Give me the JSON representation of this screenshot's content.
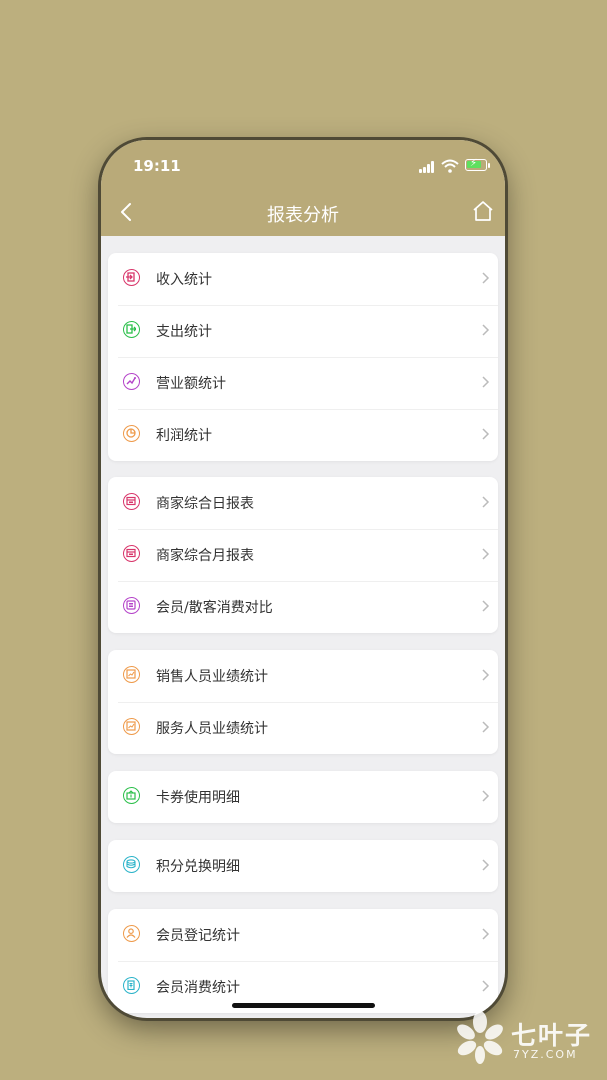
{
  "status_bar": {
    "time": "19:11"
  },
  "nav": {
    "title": "报表分析"
  },
  "colors": {
    "header": "#b9aa79",
    "background": "#efeff1",
    "income": "#d8356a",
    "expense": "#2bbf4a",
    "turnover": "#b443c9",
    "profit": "#ee9a4a",
    "daily": "#d8356a",
    "monthly": "#d8356a",
    "compare": "#b443c9",
    "sales_perf": "#ee9a4a",
    "service_perf": "#ee9a4a",
    "card_usage": "#2bbf4a",
    "points": "#2bb3c9",
    "member_reg": "#ee9a4a",
    "member_consume": "#2bb3c9"
  },
  "groups": [
    {
      "items": [
        {
          "label": "收入统计",
          "icon": "income-icon"
        },
        {
          "label": "支出统计",
          "icon": "expense-icon"
        },
        {
          "label": "营业额统计",
          "icon": "turnover-icon"
        },
        {
          "label": "利润统计",
          "icon": "profit-pie-icon"
        }
      ]
    },
    {
      "items": [
        {
          "label": "商家综合日报表",
          "icon": "calendar-icon"
        },
        {
          "label": "商家综合月报表",
          "icon": "calendar-icon"
        },
        {
          "label": "会员/散客消费对比",
          "icon": "compare-icon"
        }
      ]
    },
    {
      "items": [
        {
          "label": "销售人员业绩统计",
          "icon": "chart-icon"
        },
        {
          "label": "服务人员业绩统计",
          "icon": "chart-icon"
        }
      ]
    },
    {
      "items": [
        {
          "label": "卡券使用明细",
          "icon": "coupon-icon"
        }
      ]
    },
    {
      "items": [
        {
          "label": "积分兑换明细",
          "icon": "points-icon"
        }
      ]
    },
    {
      "items": [
        {
          "label": "会员登记统计",
          "icon": "user-icon"
        },
        {
          "label": "会员消费统计",
          "icon": "receipt-icon"
        }
      ]
    }
  ],
  "watermark": {
    "text": "七叶子",
    "sub": "7YZ.COM"
  }
}
